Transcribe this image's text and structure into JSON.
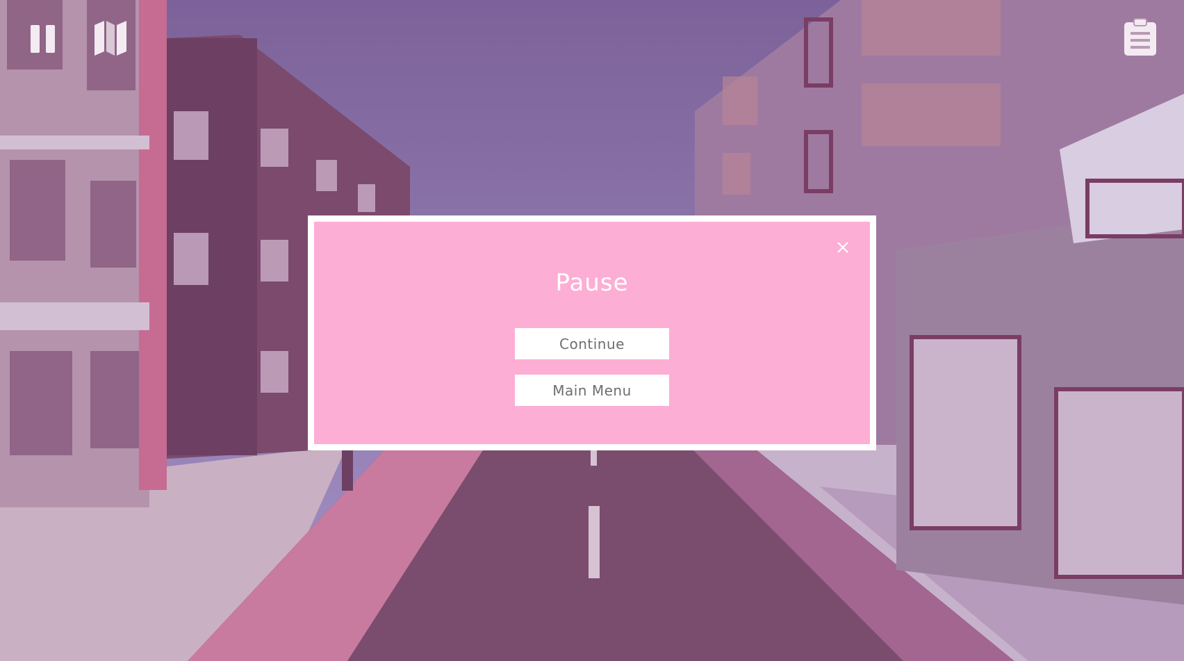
{
  "hud": {
    "pause_icon": "pause-icon",
    "map_icon": "map-icon",
    "tasks_icon": "clipboard-icon"
  },
  "pause_dialog": {
    "title": "Pause",
    "close_icon": "close-icon",
    "buttons": {
      "continue": "Continue",
      "main_menu": "Main Menu"
    }
  },
  "colors": {
    "dialog_background": "#fdaed5",
    "dialog_border": "#ffffff",
    "title_text": "#ffffff",
    "button_background": "#ffffff",
    "button_text": "#6e6e6e"
  }
}
